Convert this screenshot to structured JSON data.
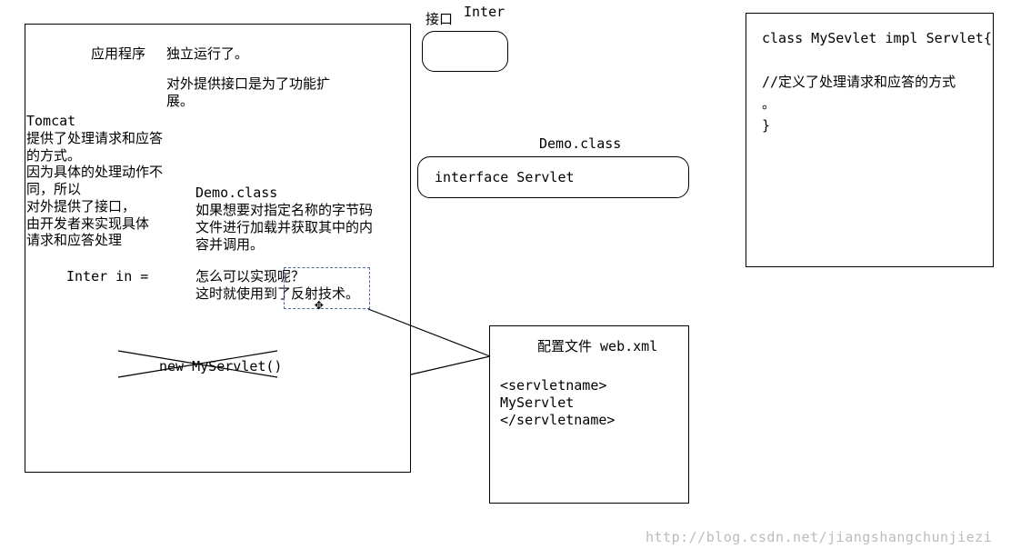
{
  "labels": {
    "iface_top": "接口",
    "inter": "Inter",
    "app_title": "应用程序",
    "app_line1": "独立运行了。",
    "app_line2": "对外提供接口是为了功能扩\n展。",
    "tomcat": "Tomcat\n提供了处理请求和应答\n的方式。\n因为具体的处理动作不\n同，所以\n对外提供了接口，\n由开发者来实现具体\n请求和应答处理",
    "demo_left": "Demo.class",
    "demo_explain": "如果想要对指定名称的字节码\n文件进行加载并获取其中的内\n容并调用。",
    "inter_in": "Inter in =",
    "realize_q": "怎么可以实现呢？",
    "reflect": "这时就使用到了反射技术。",
    "new_servlet": "new MyServlet()",
    "config_title": "配置文件 web.xml",
    "config_body": "<servletname>\nMyServlet\n</servletname>",
    "demo_mid": "Demo.class",
    "iface_servlet": "interface Servlet",
    "class_code": "class MySevlet impl Servlet{\n\n//定义了处理请求和应答的方式\n。\n}",
    "watermark": "http://blog.csdn.net/jiangshangchunjiezi"
  }
}
